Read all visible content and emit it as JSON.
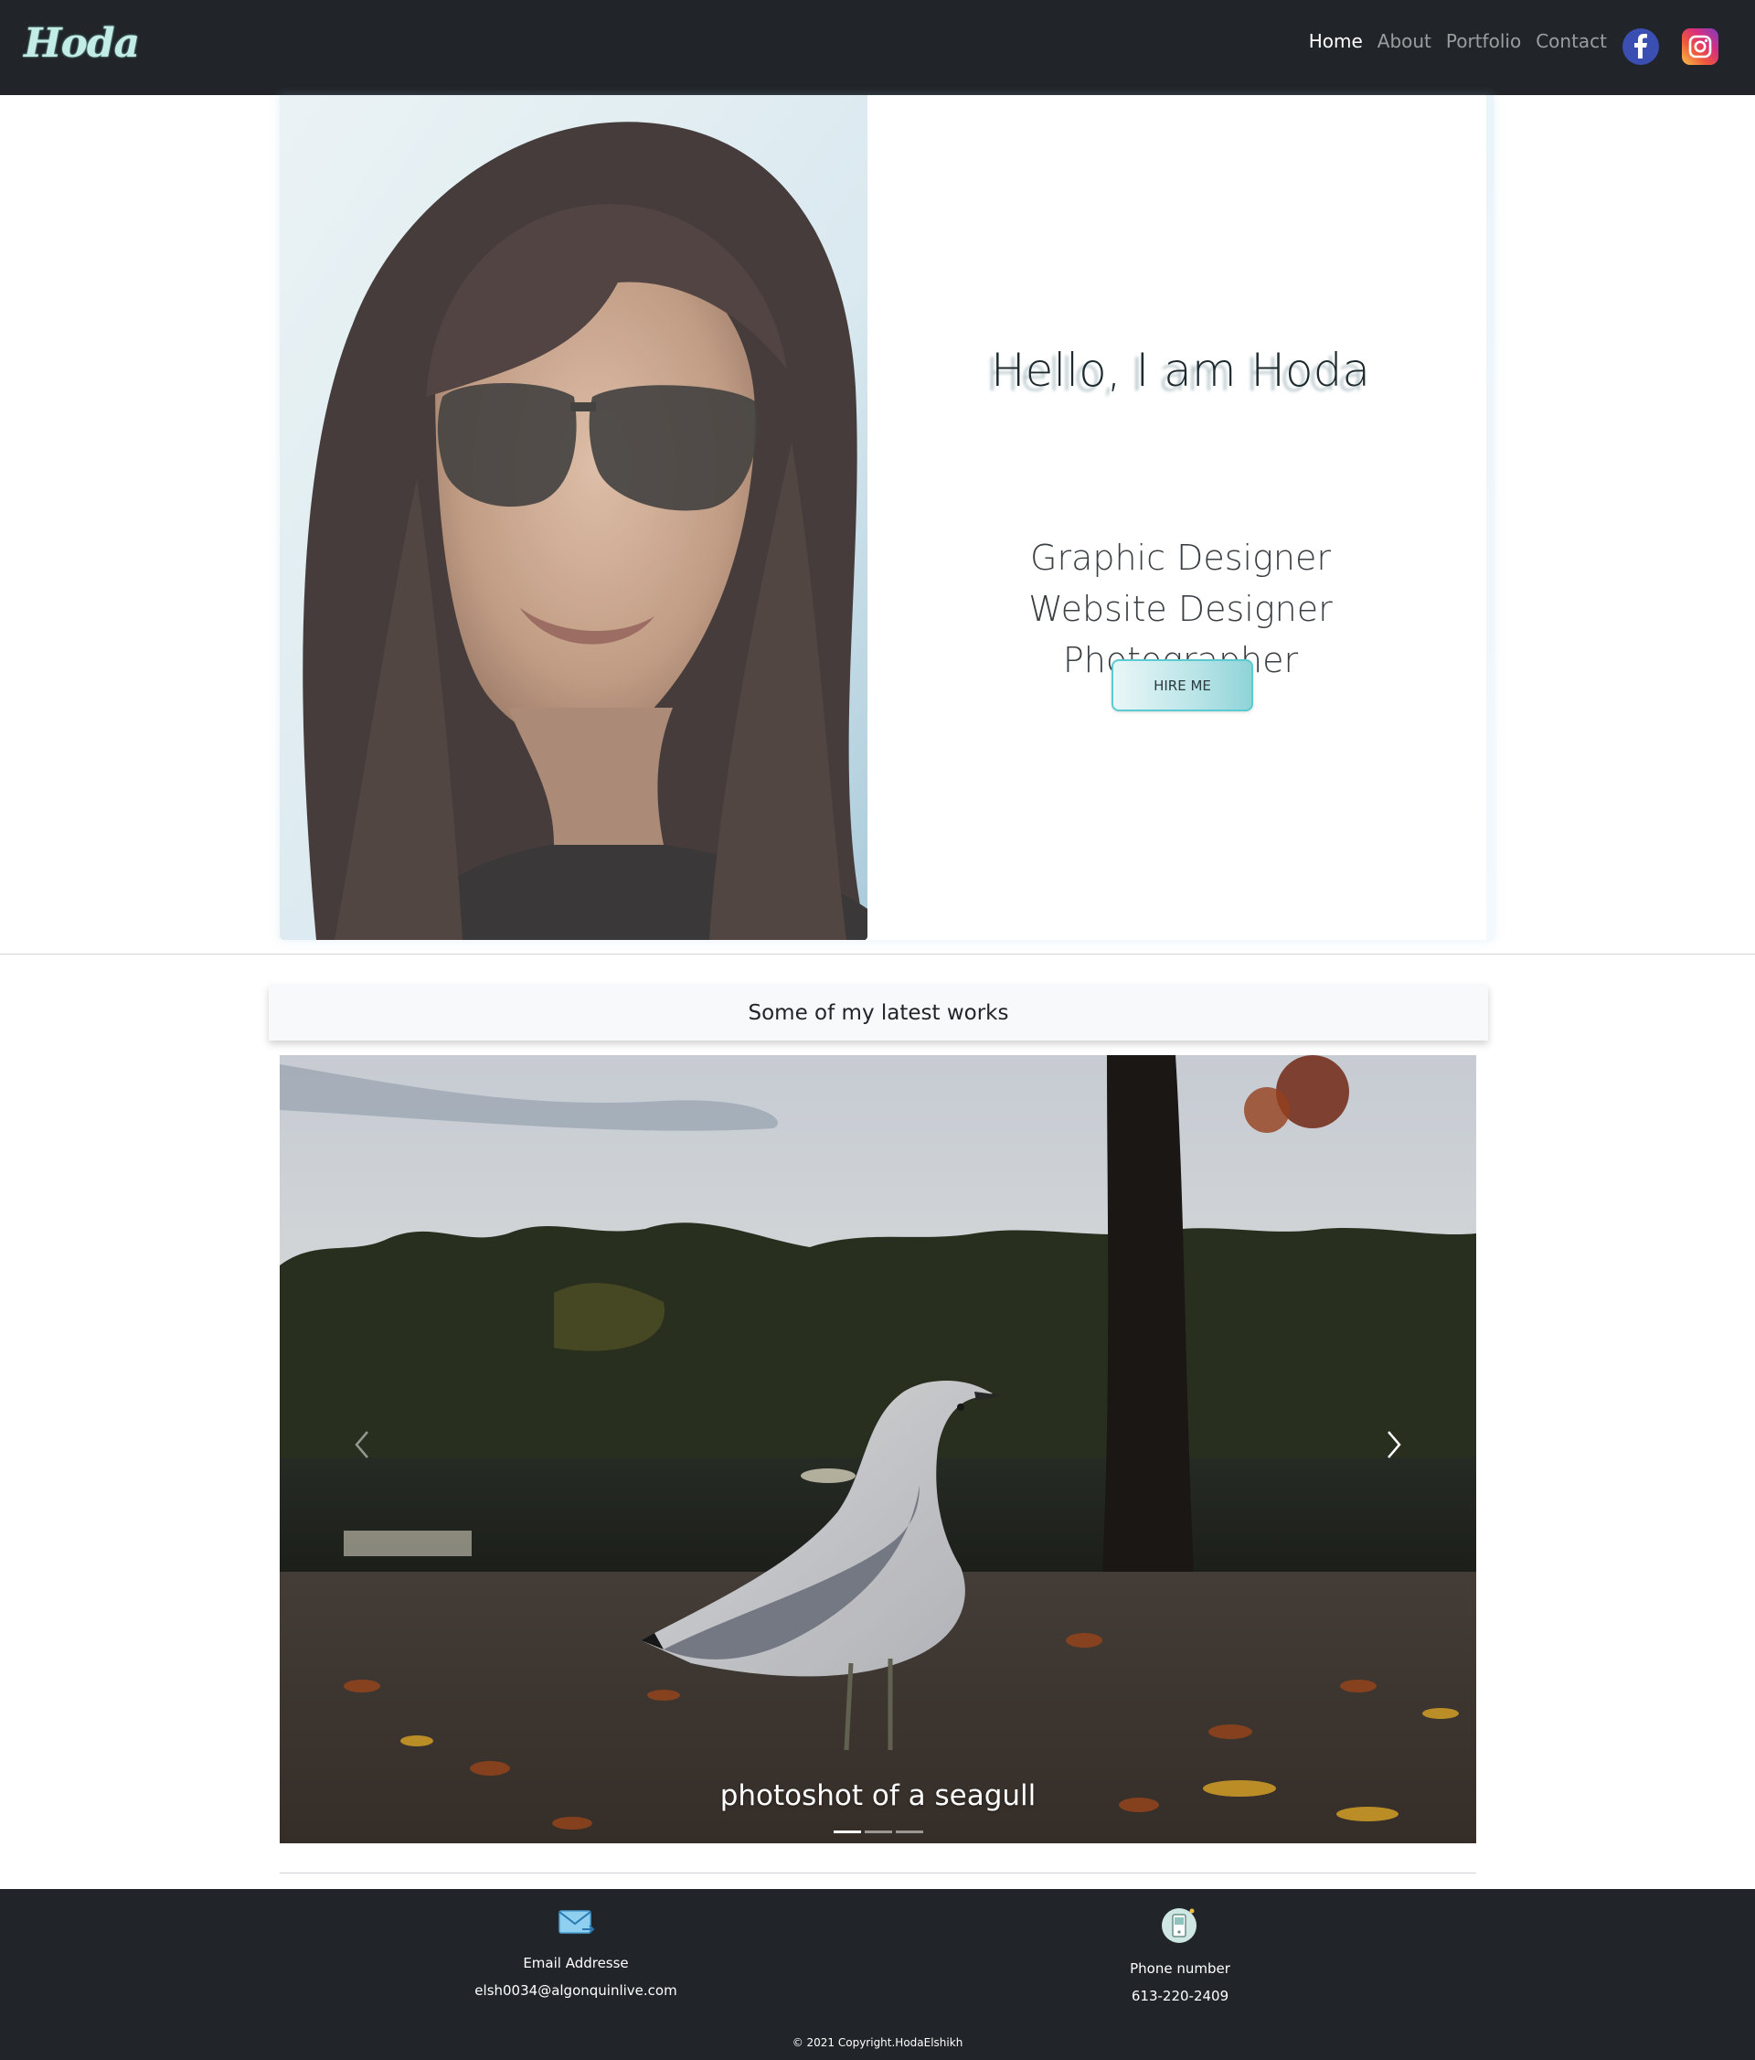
{
  "nav": {
    "logo_text": "Hoda",
    "links": [
      {
        "label": "Home",
        "active": true
      },
      {
        "label": "About",
        "active": false
      },
      {
        "label": "Portfolio",
        "active": false
      },
      {
        "label": "Contact",
        "active": false
      }
    ],
    "social": [
      {
        "name": "facebook-icon",
        "color": "#3b4fb3"
      },
      {
        "name": "instagram-icon",
        "color": "#d92e7c"
      }
    ]
  },
  "hero": {
    "greeting": "Hello, I am Hoda",
    "roles": [
      "Graphic Designer",
      "Website Designer",
      "Photographer"
    ],
    "hire_label": "HIRE ME",
    "photo_alt": "portrait-photo"
  },
  "works": {
    "heading": "Some of my latest works",
    "carousel": {
      "caption": "photoshot of a seagull",
      "slide_count": 3,
      "active_index": 0
    }
  },
  "footer": {
    "email_label": "Email Addresse",
    "email_value": "elsh0034@algonquinlive.com",
    "phone_label": "Phone number",
    "phone_value": "613-220-2409",
    "copyright": "© 2021 Copyright.HodaElshikh"
  },
  "colors": {
    "navbar_bg": "#212529",
    "accent_teal": "#5bcad1",
    "logo_color": "#c4ece6"
  }
}
